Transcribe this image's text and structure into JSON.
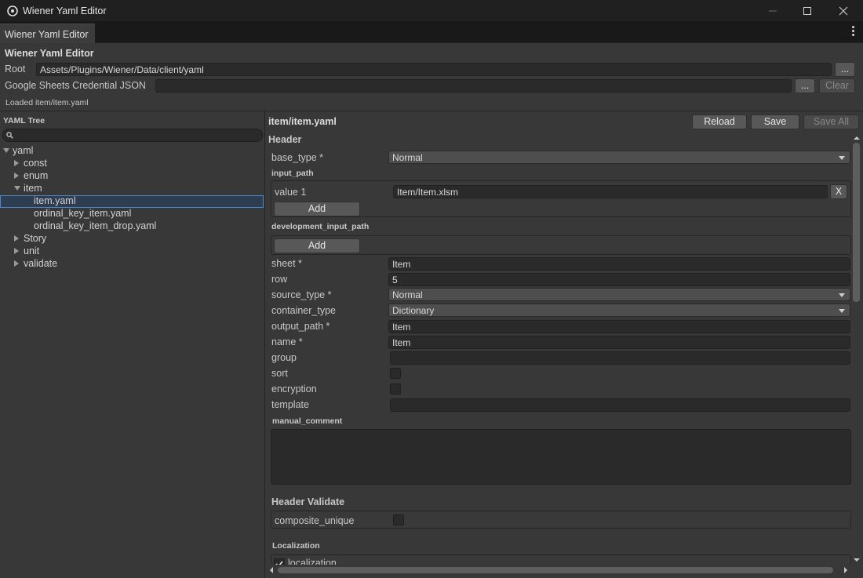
{
  "window": {
    "title": "Wiener Yaml Editor"
  },
  "tab": {
    "label": "Wiener Yaml Editor"
  },
  "top": {
    "heading": "Wiener Yaml Editor",
    "root_label": "Root",
    "root_value": "Assets/Plugins/Wiener/Data/client/yaml",
    "browse_label": "...",
    "credential_label": "Google Sheets Credential JSON",
    "credential_value": "",
    "clear_label": "Clear",
    "status": "Loaded item/item.yaml"
  },
  "tree": {
    "title": "YAML Tree",
    "search_placeholder": "",
    "items": [
      {
        "label": "yaml"
      },
      {
        "label": "const"
      },
      {
        "label": "enum"
      },
      {
        "label": "item"
      },
      {
        "label": "item.yaml"
      },
      {
        "label": "ordinal_key_item.yaml"
      },
      {
        "label": "ordinal_key_item_drop.yaml"
      },
      {
        "label": "Story"
      },
      {
        "label": "unit"
      },
      {
        "label": "validate"
      }
    ]
  },
  "editor": {
    "file": "item/item.yaml",
    "reload_label": "Reload",
    "save_label": "Save",
    "save_all_label": "Save All",
    "header_title": "Header",
    "base_type": {
      "label": "base_type *",
      "value": "Normal"
    },
    "input_path": {
      "title": "input_path",
      "value_label": "value 1",
      "value": "Item/Item.xlsm",
      "remove_label": "X",
      "add_label": "Add"
    },
    "dev_input_path": {
      "title": "development_input_path",
      "add_label": "Add"
    },
    "sheet": {
      "label": "sheet *",
      "value": "Item"
    },
    "row": {
      "label": "row",
      "value": "5"
    },
    "source_type": {
      "label": "source_type *",
      "value": "Normal"
    },
    "container_type": {
      "label": "container_type",
      "value": "Dictionary"
    },
    "output_path": {
      "label": "output_path *",
      "value": "Item"
    },
    "name": {
      "label": "name *",
      "value": "Item"
    },
    "group": {
      "label": "group",
      "value": ""
    },
    "sort": {
      "label": "sort"
    },
    "encryption": {
      "label": "encryption"
    },
    "template": {
      "label": "template",
      "value": ""
    },
    "manual_comment": {
      "title": "manual_comment",
      "value": ""
    },
    "header_validate": {
      "title": "Header Validate",
      "composite_unique_label": "composite_unique"
    },
    "localization": {
      "title": "Localization",
      "checkbox_label": "localization"
    }
  }
}
